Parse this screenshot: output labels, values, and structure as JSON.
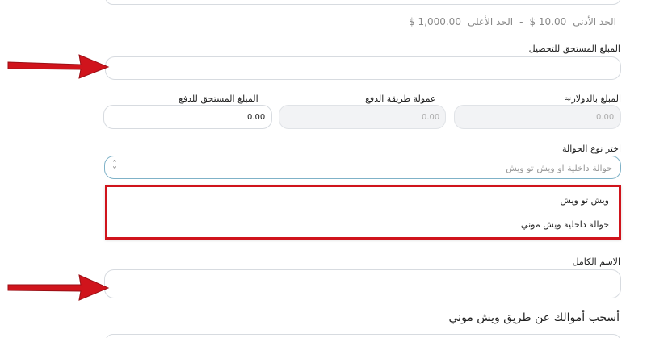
{
  "limits": {
    "min_label": "الحد الأدنى",
    "min_value": "10.00 $",
    "separator": "-",
    "max_label": "الحد الأعلى",
    "max_value": "1,000.00 $"
  },
  "collect_amount": {
    "label": "المبلغ المستحق للتحصيل",
    "value": ""
  },
  "usd_amount": {
    "label": "المبلغ بالدولار≈",
    "value": "0.00"
  },
  "payment_fee": {
    "label": "عمولة طريقة الدفع",
    "value": "0.00"
  },
  "payment_due": {
    "label": "المبلغ المستحق للدفع",
    "value": "0.00"
  },
  "transfer_type": {
    "label": "اختر نوع الحوالة",
    "placeholder": "حوالة داخلية او ويش تو ويش",
    "options": [
      "ويش تو ويش",
      "حوالة داخلية ويش موني"
    ]
  },
  "full_name": {
    "label": "الاسم الكامل",
    "value": ""
  },
  "section_title": "أسحب أموالك عن طريق ويش موني",
  "colors": {
    "annotation_red": "#d0141c",
    "border": "#d7dbe0",
    "focus_border": "#7fb2c8"
  },
  "icons": {
    "select": "updown-chevron-icon",
    "annotation": "red-arrow-icon"
  }
}
